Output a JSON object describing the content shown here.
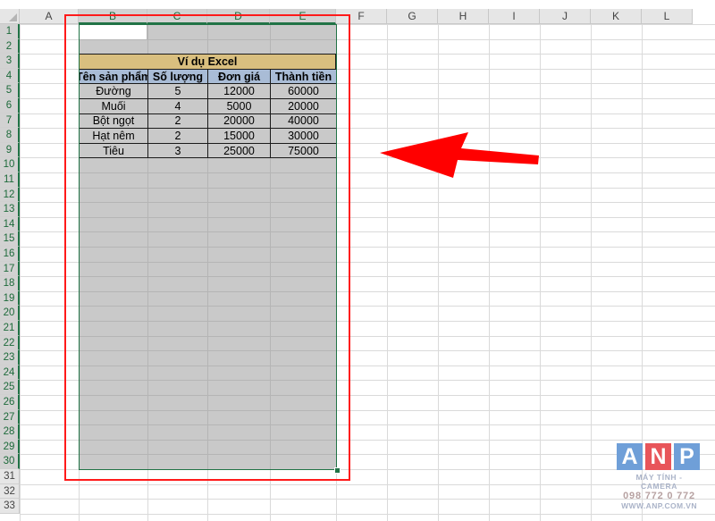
{
  "columns": [
    "A",
    "B",
    "C",
    "D",
    "E",
    "F",
    "G",
    "H",
    "I",
    "J",
    "K",
    "L"
  ],
  "rows": [
    "1",
    "2",
    "3",
    "4",
    "5",
    "6",
    "7",
    "8",
    "9",
    "10",
    "11",
    "12",
    "13",
    "14",
    "15",
    "16",
    "17",
    "18",
    "19",
    "20",
    "21",
    "22",
    "23",
    "24",
    "25",
    "26",
    "27",
    "28",
    "29",
    "30",
    "31",
    "32",
    "33"
  ],
  "table": {
    "title": "Ví dụ Excel",
    "headers": [
      "Tên sản phẩm",
      "Số lượng",
      "Đơn giá",
      "Thành tiền"
    ],
    "rows": [
      [
        "Đường",
        "5",
        "12000",
        "60000"
      ],
      [
        "Muối",
        "4",
        "5000",
        "20000"
      ],
      [
        "Bột ngọt",
        "2",
        "20000",
        "40000"
      ],
      [
        "Hạt nêm",
        "2",
        "15000",
        "30000"
      ],
      [
        "Tiêu",
        "3",
        "25000",
        "75000"
      ]
    ]
  },
  "selection": {
    "range": "B1:E30",
    "columns": [
      "B",
      "C",
      "D",
      "E"
    ],
    "first_row": 1,
    "last_row": 30
  },
  "annotation": {
    "frame_color": "#ff1a1a",
    "arrow_color": "#ff0000"
  },
  "watermark": {
    "letters": [
      "A",
      "N",
      "P"
    ],
    "letter_colors": [
      "#6f9fd8",
      "#e8555a",
      "#6f9fd8"
    ],
    "tagline": "MÁY TÍNH - CAMERA",
    "phone": "098 772 0 772",
    "website": "WWW.ANP.COM.VN"
  },
  "colors": {
    "header_fill": "#a9bcd6",
    "title_fill": "#d9bf7f",
    "selection_shade": "#c9c9c9",
    "selection_accent": "#217346"
  }
}
